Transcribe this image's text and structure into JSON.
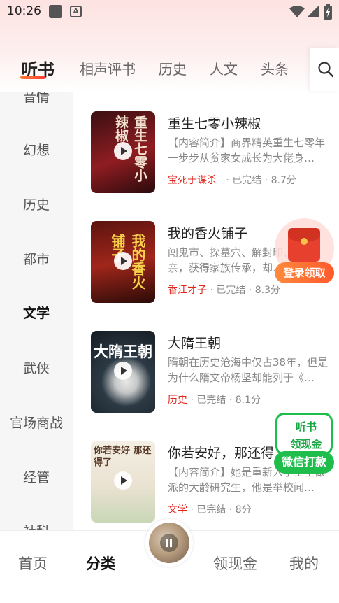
{
  "status_bar": {
    "time": "10:26"
  },
  "top_tabs": [
    "听书",
    "相声评书",
    "历史",
    "人文",
    "头条"
  ],
  "sidebar": [
    "音情",
    "幻想",
    "历史",
    "都市",
    "文学",
    "武侠",
    "官场商战",
    "经管",
    "社科"
  ],
  "books": [
    {
      "title": "重生七零小辣椒",
      "desc": "【内容简介】商界精英重生七零年一步步从贫家女成长为大佬身…",
      "author": "宝死于谋杀",
      "status": "已完结",
      "score": "8.7分",
      "cover_text": "重生七零小辣椒"
    },
    {
      "title": "我的香火铺子",
      "desc": "闯鬼市、探墓穴、解封印、寻双亲，获得家族传承，却…",
      "author": "香江才子",
      "status": "已完结",
      "score": "8.3分",
      "cover_text": "我的香火铺子"
    },
    {
      "title": "大隋王朝",
      "desc": "隋朝在历史沧海中仅占38年，但是为什么隋文帝杨坚却能列于《…",
      "author": "历史",
      "status": "已完结",
      "score": "8.1分",
      "cover_text": "大隋王朝"
    },
    {
      "title": "你若安好，那还得了",
      "desc": "【内容简介】她是重新入学土生做派的大龄研究生，他是举校闻…",
      "author": "文学",
      "status": "已完结",
      "score": "8分",
      "cover_text": "你若安好 那还得了"
    }
  ],
  "floating": {
    "red_pill": "登录领取",
    "green_line1": "听书",
    "green_line2": "领现金",
    "green_pill": "微信打款"
  },
  "bottom_nav": [
    "首页",
    "分类",
    "领现金",
    "我的"
  ],
  "colors": {
    "accent": "#e0241c",
    "green": "#1fbe4c"
  }
}
